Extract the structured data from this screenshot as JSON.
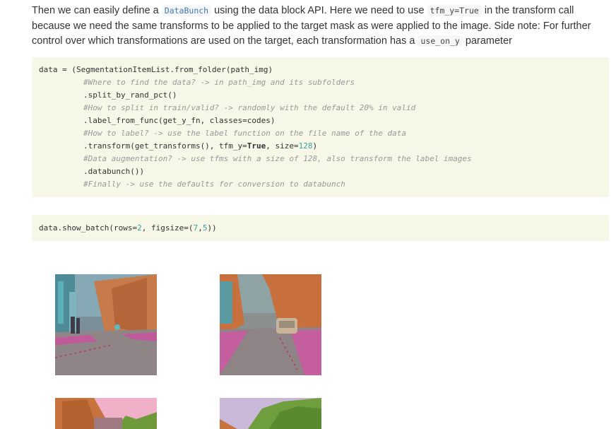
{
  "paragraph": {
    "t1": "Then we can easily define a ",
    "c1": "DataBunch",
    "t2": " using the data block API. Here we need to use ",
    "c2": "tfm_y=True",
    "t3": " in the transform call because we need the same transforms to be applied to the target mask as were applied to the image. Side note: For further control over which transformations are used on the target, each transformation has a ",
    "c3": "use_on_y",
    "t4": " parameter"
  },
  "cell1": {
    "l1": "data = (SegmentationItemList.from_folder(path_img)",
    "l2": "#Where to find the data? -> in path_img and its subfolders",
    "l3": ".split_by_rand_pct()",
    "l4": "#How to split in train/valid? -> randomly with the default 20% in valid",
    "l5": ".label_from_func(get_y_fn, classes=codes)",
    "l6": "#How to label? -> use the label function on the file name of the data",
    "l7a": ".transform(get_transforms(), tfm_y=",
    "l7b": "True",
    "l7c": ", size=",
    "l7d": "128",
    "l7e": ")",
    "l8": "#Data augmentation? -> use tfms with a size of 128, also transform the label images",
    "l9": ".databunch())",
    "l10": "#Finally -> use the defaults for conversion to databunch"
  },
  "cell2": {
    "a": "data.show_batch(rows=",
    "b": "2",
    "c": ", figsize=(",
    "d": "7",
    "e": ",",
    "f": "5",
    "g": "))"
  },
  "colors": {
    "code_bg": "#f7f7e8",
    "comment": "#999999",
    "number": "#3a9e9e",
    "inline_code_blue": "#3b79b8"
  }
}
